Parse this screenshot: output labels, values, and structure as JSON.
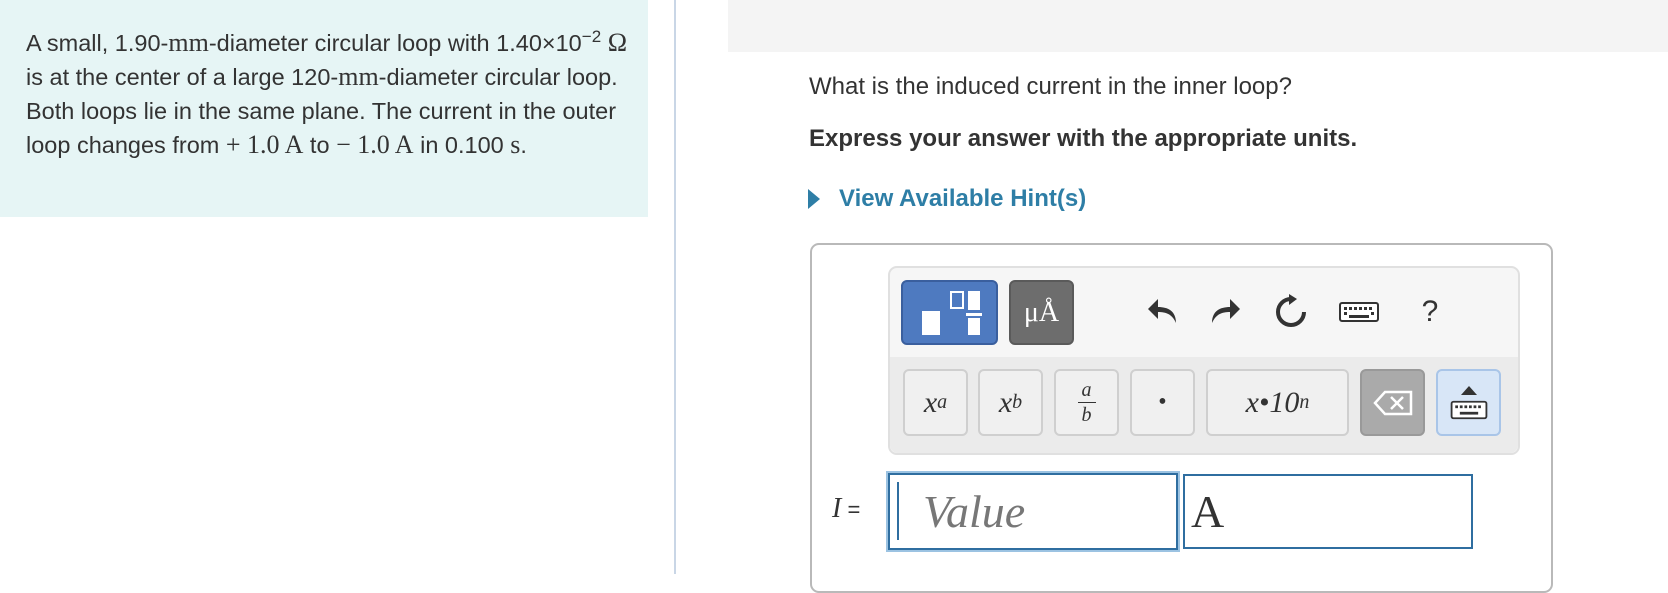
{
  "problem": {
    "t1": "A small, 1.90-",
    "mm1": "mm",
    "t2": "-diameter circular loop with 1.40×10",
    "exp": "−2",
    "omega": "Ω",
    "t3": " is at the center of a large 120-",
    "mm2": "mm",
    "t4": "-diameter circular loop. Both loops lie in the same plane. The current in the outer loop changes from ",
    "v1": "+ 1.0 A",
    "t5": " to ",
    "v2": "− 1.0 A",
    "t6": " in 0.100 ",
    "s": "s",
    "t7": "."
  },
  "question": "What is the induced current in the inner loop?",
  "instruction": "Express your answer with the appropriate units.",
  "hint_label": "View Available Hint(s)",
  "toolbar": {
    "units_label": "μÅ",
    "help_label": "?",
    "keys": {
      "superscript_base": "x",
      "superscript_exp": "a",
      "subscript_base": "x",
      "subscript_sub": "b",
      "frac_num": "a",
      "frac_den": "b",
      "dot": "•",
      "sci": "x•10",
      "sci_exp": "n"
    }
  },
  "answer": {
    "variable": "I",
    "equals": " =",
    "value_placeholder": "Value",
    "unit_value": "A"
  }
}
